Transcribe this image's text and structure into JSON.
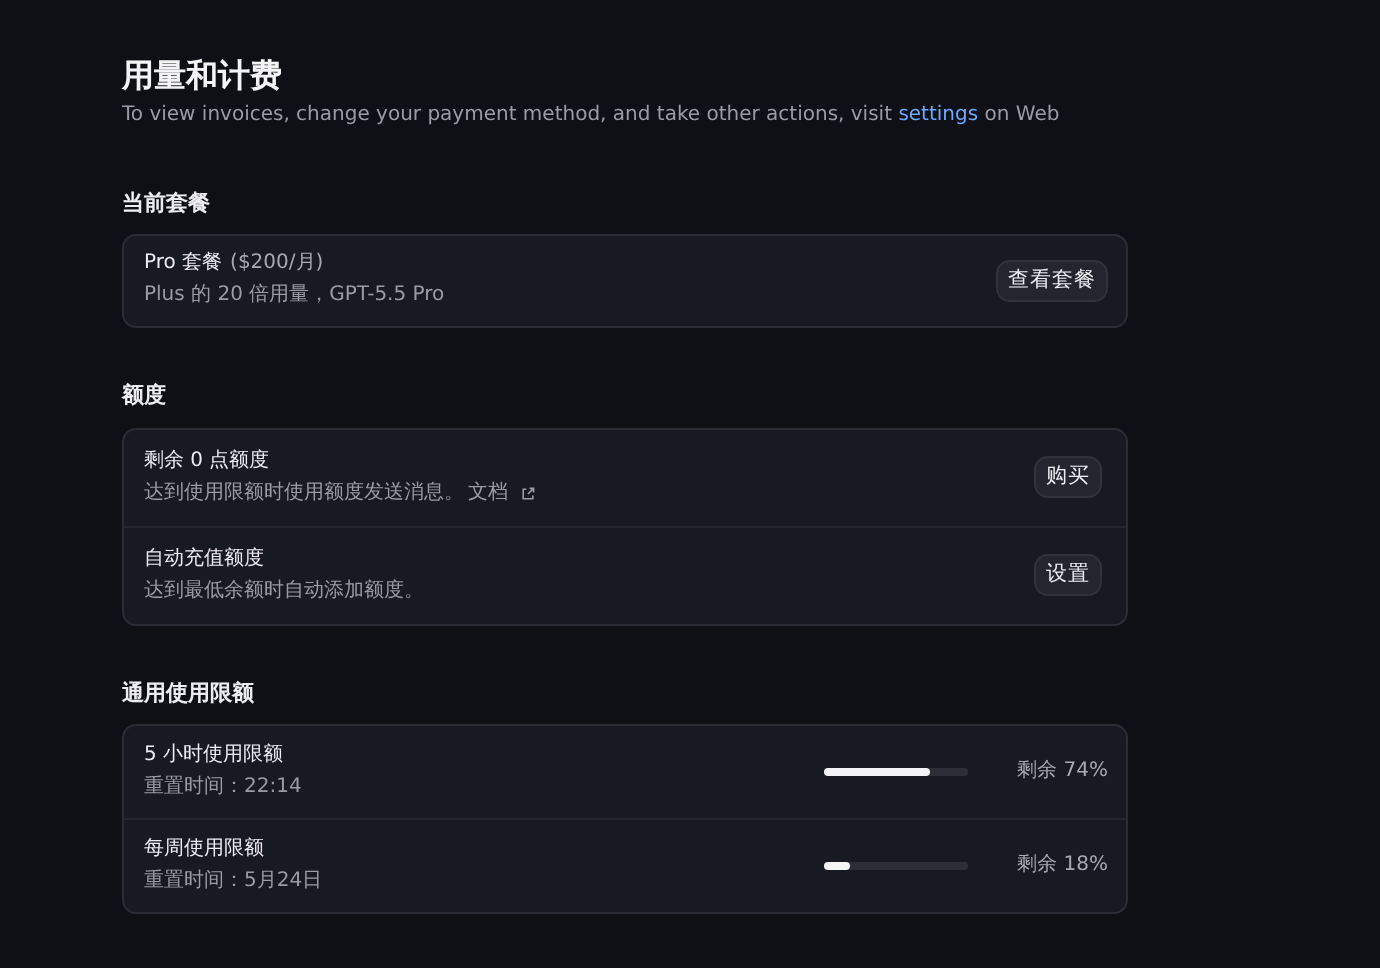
{
  "page": {
    "title": "用量和计费",
    "subtitle_before": "To view invoices, change your payment method, and take other actions, visit",
    "subtitle_link": "settings",
    "subtitle_after": "on Web"
  },
  "plan": {
    "heading": "当前套餐",
    "name": "Pro 套餐",
    "price": "($200/月)",
    "description": "Plus 的 20 倍用量，GPT-5.5 Pro",
    "button": "查看套餐"
  },
  "credits": {
    "heading": "额度",
    "rows": [
      {
        "title": "剩余 0 点额度",
        "description": "达到使用限额时使用额度发送消息。",
        "link": "文档",
        "button": "购买"
      },
      {
        "title": "自动充值额度",
        "description": "达到最低余额时自动添加额度。",
        "button": "设置"
      }
    ]
  },
  "limits": {
    "heading": "通用使用限额",
    "rows": [
      {
        "title": "5 小时使用限额",
        "reset": "重置时间：22:14",
        "level": 0.74,
        "reading": "剩余 74%"
      },
      {
        "title": "每周使用限额",
        "reset": "重置时间：5月24日",
        "level": 0.18,
        "reading": "剩余 18%"
      }
    ]
  }
}
